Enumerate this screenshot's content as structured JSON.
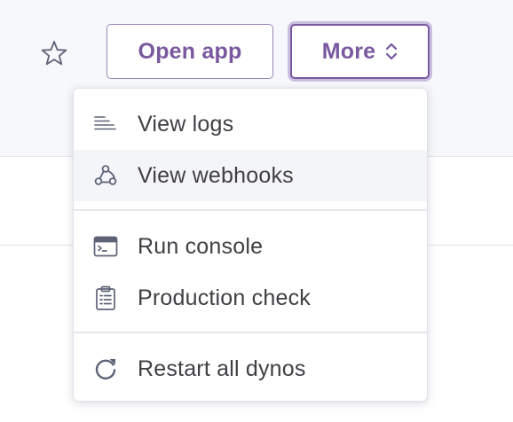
{
  "header": {
    "favorite_icon": "star-icon",
    "open_app_label": "Open app",
    "more_label": "More",
    "more_icon": "chevron-up-down-icon"
  },
  "menu": {
    "groups": [
      {
        "items": [
          {
            "label": "View logs",
            "icon": "logs-lines-icon"
          },
          {
            "label": "View webhooks",
            "icon": "webhook-icon",
            "highlighted": true
          }
        ]
      },
      {
        "items": [
          {
            "label": "Run console",
            "icon": "console-window-icon"
          },
          {
            "label": "Production check",
            "icon": "clipboard-checklist-icon"
          }
        ]
      },
      {
        "items": [
          {
            "label": "Restart all dynos",
            "icon": "restart-icon"
          }
        ]
      }
    ]
  },
  "colors": {
    "accent": "#79589f",
    "icon": "#5d6377",
    "text": "#3f3f44",
    "header_bg": "#f7f8fb",
    "hover_bg": "#f4f5f9"
  }
}
